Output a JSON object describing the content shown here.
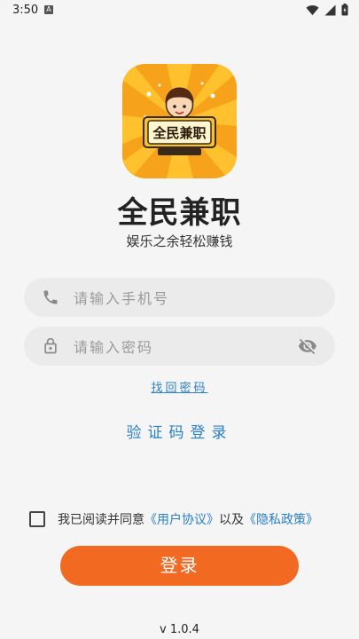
{
  "status_bar": {
    "time": "3:50",
    "notification_badge": "A"
  },
  "app": {
    "name": "全民兼职",
    "slogan": "娱乐之余轻松赚钱",
    "logo_text": "全民兼职"
  },
  "form": {
    "phone_placeholder": "请输入手机号",
    "password_placeholder": "请输入密码",
    "forgot_password": "找回密码",
    "code_login": "验证码登录"
  },
  "agreement": {
    "prefix": "我已阅读并同意",
    "user_agreement": "《用户协议》",
    "and": "以及",
    "privacy_policy": "《隐私政策》",
    "checked": false
  },
  "login_button": "登录",
  "version": "v 1.0.4",
  "colors": {
    "accent": "#f26a22",
    "link": "#2a7fc9",
    "logo_bg": "#f7a21b"
  }
}
